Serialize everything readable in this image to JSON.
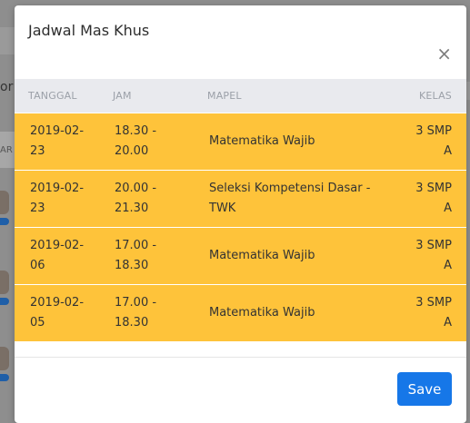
{
  "modal": {
    "title": "Jadwal Mas Khus",
    "close_glyph": "×",
    "save_label": "Save"
  },
  "table": {
    "headers": [
      "TANGGAL",
      "JAM",
      "MAPEL",
      "KELAS"
    ],
    "rows": [
      {
        "tanggal": "2019-02-\n23",
        "jam": "18.30 -\n20.00",
        "mapel": "Matematika Wajib",
        "kelas": "3 SMP\nA"
      },
      {
        "tanggal": "2019-02-\n23",
        "jam": "20.00 -\n21.30",
        "mapel": "Seleksi Kompetensi Dasar -\nTWK",
        "kelas": "3 SMP\nA"
      },
      {
        "tanggal": "2019-02-\n06",
        "jam": "17.00 -\n18.30",
        "mapel": "Matematika Wajib",
        "kelas": "3 SMP\nA"
      },
      {
        "tanggal": "2019-02-\n05",
        "jam": "17.00 -\n18.30",
        "mapel": "Matematika Wajib",
        "kelas": "3 SMP\nA"
      }
    ]
  },
  "background": {
    "fragment_text": "or",
    "fragment_label": "AR"
  },
  "colors": {
    "row_highlight": "#fec33a",
    "header_bg": "#e9eaee",
    "primary_button": "#1677e8",
    "overlay": "#8e8e8e"
  }
}
